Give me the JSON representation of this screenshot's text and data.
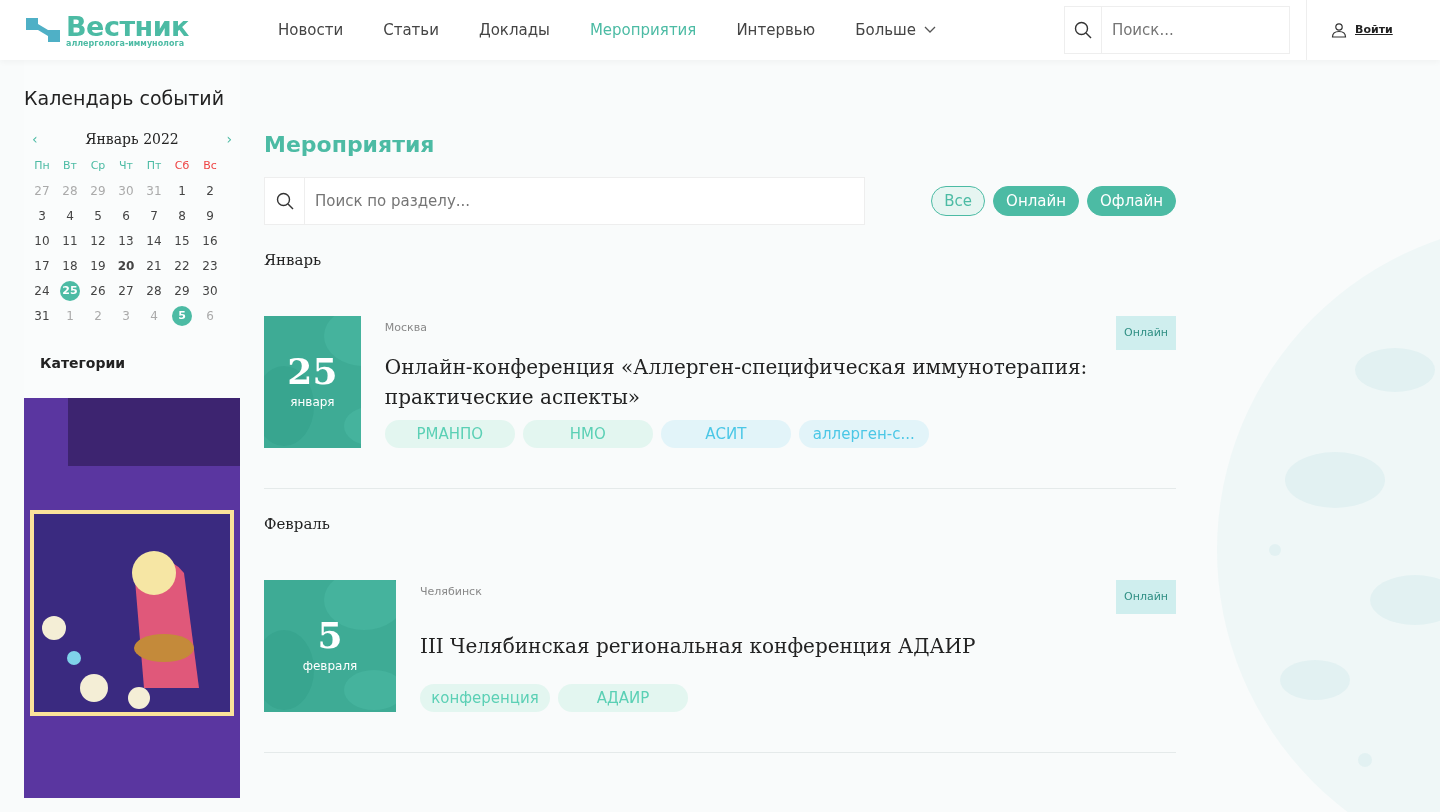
{
  "logo": {
    "title": "Вестник",
    "subtitle": "аллерголога-иммунолога"
  },
  "nav": [
    {
      "label": "Новости",
      "selected": false
    },
    {
      "label": "Статьи",
      "selected": false
    },
    {
      "label": "Доклады",
      "selected": false
    },
    {
      "label": "Мероприятия",
      "selected": true
    },
    {
      "label": "Интервью",
      "selected": false
    },
    {
      "label": "Больше",
      "selected": false,
      "dropdown": true
    }
  ],
  "search": {
    "placeholder": "Поиск..."
  },
  "login": "Войти",
  "calendar": {
    "title": "Календарь событий",
    "prev": "‹",
    "next": "›",
    "month": "Январь 2022",
    "weekdays": [
      {
        "label": "Пн",
        "weekend": false
      },
      {
        "label": "Вт",
        "weekend": false
      },
      {
        "label": "Ср",
        "weekend": false
      },
      {
        "label": "Чт",
        "weekend": false
      },
      {
        "label": "Пт",
        "weekend": false
      },
      {
        "label": "Сб",
        "weekend": true
      },
      {
        "label": "Вс",
        "weekend": true
      }
    ],
    "weeks": [
      [
        {
          "day": "27",
          "kind": "other"
        },
        {
          "day": "28",
          "kind": "other"
        },
        {
          "day": "29",
          "kind": "other"
        },
        {
          "day": "30",
          "kind": "other"
        },
        {
          "day": "31",
          "kind": "other"
        },
        {
          "day": "1",
          "kind": "current"
        },
        {
          "day": "2",
          "kind": "current"
        }
      ],
      [
        {
          "day": "3",
          "kind": "current"
        },
        {
          "day": "4",
          "kind": "current"
        },
        {
          "day": "5",
          "kind": "current"
        },
        {
          "day": "6",
          "kind": "current"
        },
        {
          "day": "7",
          "kind": "current"
        },
        {
          "day": "8",
          "kind": "current"
        },
        {
          "day": "9",
          "kind": "current"
        }
      ],
      [
        {
          "day": "10",
          "kind": "current"
        },
        {
          "day": "11",
          "kind": "current"
        },
        {
          "day": "12",
          "kind": "current"
        },
        {
          "day": "13",
          "kind": "current"
        },
        {
          "day": "14",
          "kind": "current"
        },
        {
          "day": "15",
          "kind": "current"
        },
        {
          "day": "16",
          "kind": "current"
        }
      ],
      [
        {
          "day": "17",
          "kind": "current"
        },
        {
          "day": "18",
          "kind": "current"
        },
        {
          "day": "19",
          "kind": "current"
        },
        {
          "day": "20",
          "kind": "today"
        },
        {
          "day": "21",
          "kind": "current"
        },
        {
          "day": "22",
          "kind": "current"
        },
        {
          "day": "23",
          "kind": "current"
        }
      ],
      [
        {
          "day": "24",
          "kind": "current"
        },
        {
          "day": "25",
          "kind": "event"
        },
        {
          "day": "26",
          "kind": "current"
        },
        {
          "day": "27",
          "kind": "current"
        },
        {
          "day": "28",
          "kind": "current"
        },
        {
          "day": "29",
          "kind": "current"
        },
        {
          "day": "30",
          "kind": "current"
        }
      ],
      [
        {
          "day": "31",
          "kind": "current"
        },
        {
          "day": "1",
          "kind": "other"
        },
        {
          "day": "2",
          "kind": "other"
        },
        {
          "day": "3",
          "kind": "other"
        },
        {
          "day": "4",
          "kind": "other"
        },
        {
          "day": "5",
          "kind": "event"
        },
        {
          "day": "6",
          "kind": "other"
        }
      ]
    ]
  },
  "categories_title": "Категории",
  "page_title": "Мероприятия",
  "section_search": {
    "placeholder": "Поиск по разделу..."
  },
  "filters": [
    {
      "label": "Все",
      "selected": true
    },
    {
      "label": "Онлайн",
      "selected": false
    },
    {
      "label": "Офлайн",
      "selected": false
    }
  ],
  "groups": [
    {
      "month": "Январь",
      "events": [
        {
          "day": "25",
          "month": "января",
          "city": "Москва",
          "title": "Онлайн-конференция «Аллерген-специфическая иммунотерапия: практические аспекты»",
          "format": "Онлайн",
          "tags": [
            {
              "label": "РМАНПО",
              "color": "#e3f6f0"
            },
            {
              "label": "НМО",
              "color": "#e3f6f0"
            },
            {
              "label": "АСИТ",
              "color": "#e2f4f9"
            },
            {
              "label": "аллерген-с...",
              "color": "#e2f4f9"
            }
          ]
        }
      ]
    },
    {
      "month": "Февраль",
      "events": [
        {
          "day": "5",
          "month": "февраля",
          "city": "Челябинск",
          "title": "III Челябинская региональная конференция АДАИР",
          "format": "Онлайн",
          "tags": [
            {
              "label": "конференция",
              "color": "#e3f6f0"
            },
            {
              "label": "АДАИР",
              "color": "#e3f6f0"
            }
          ]
        }
      ]
    }
  ]
}
